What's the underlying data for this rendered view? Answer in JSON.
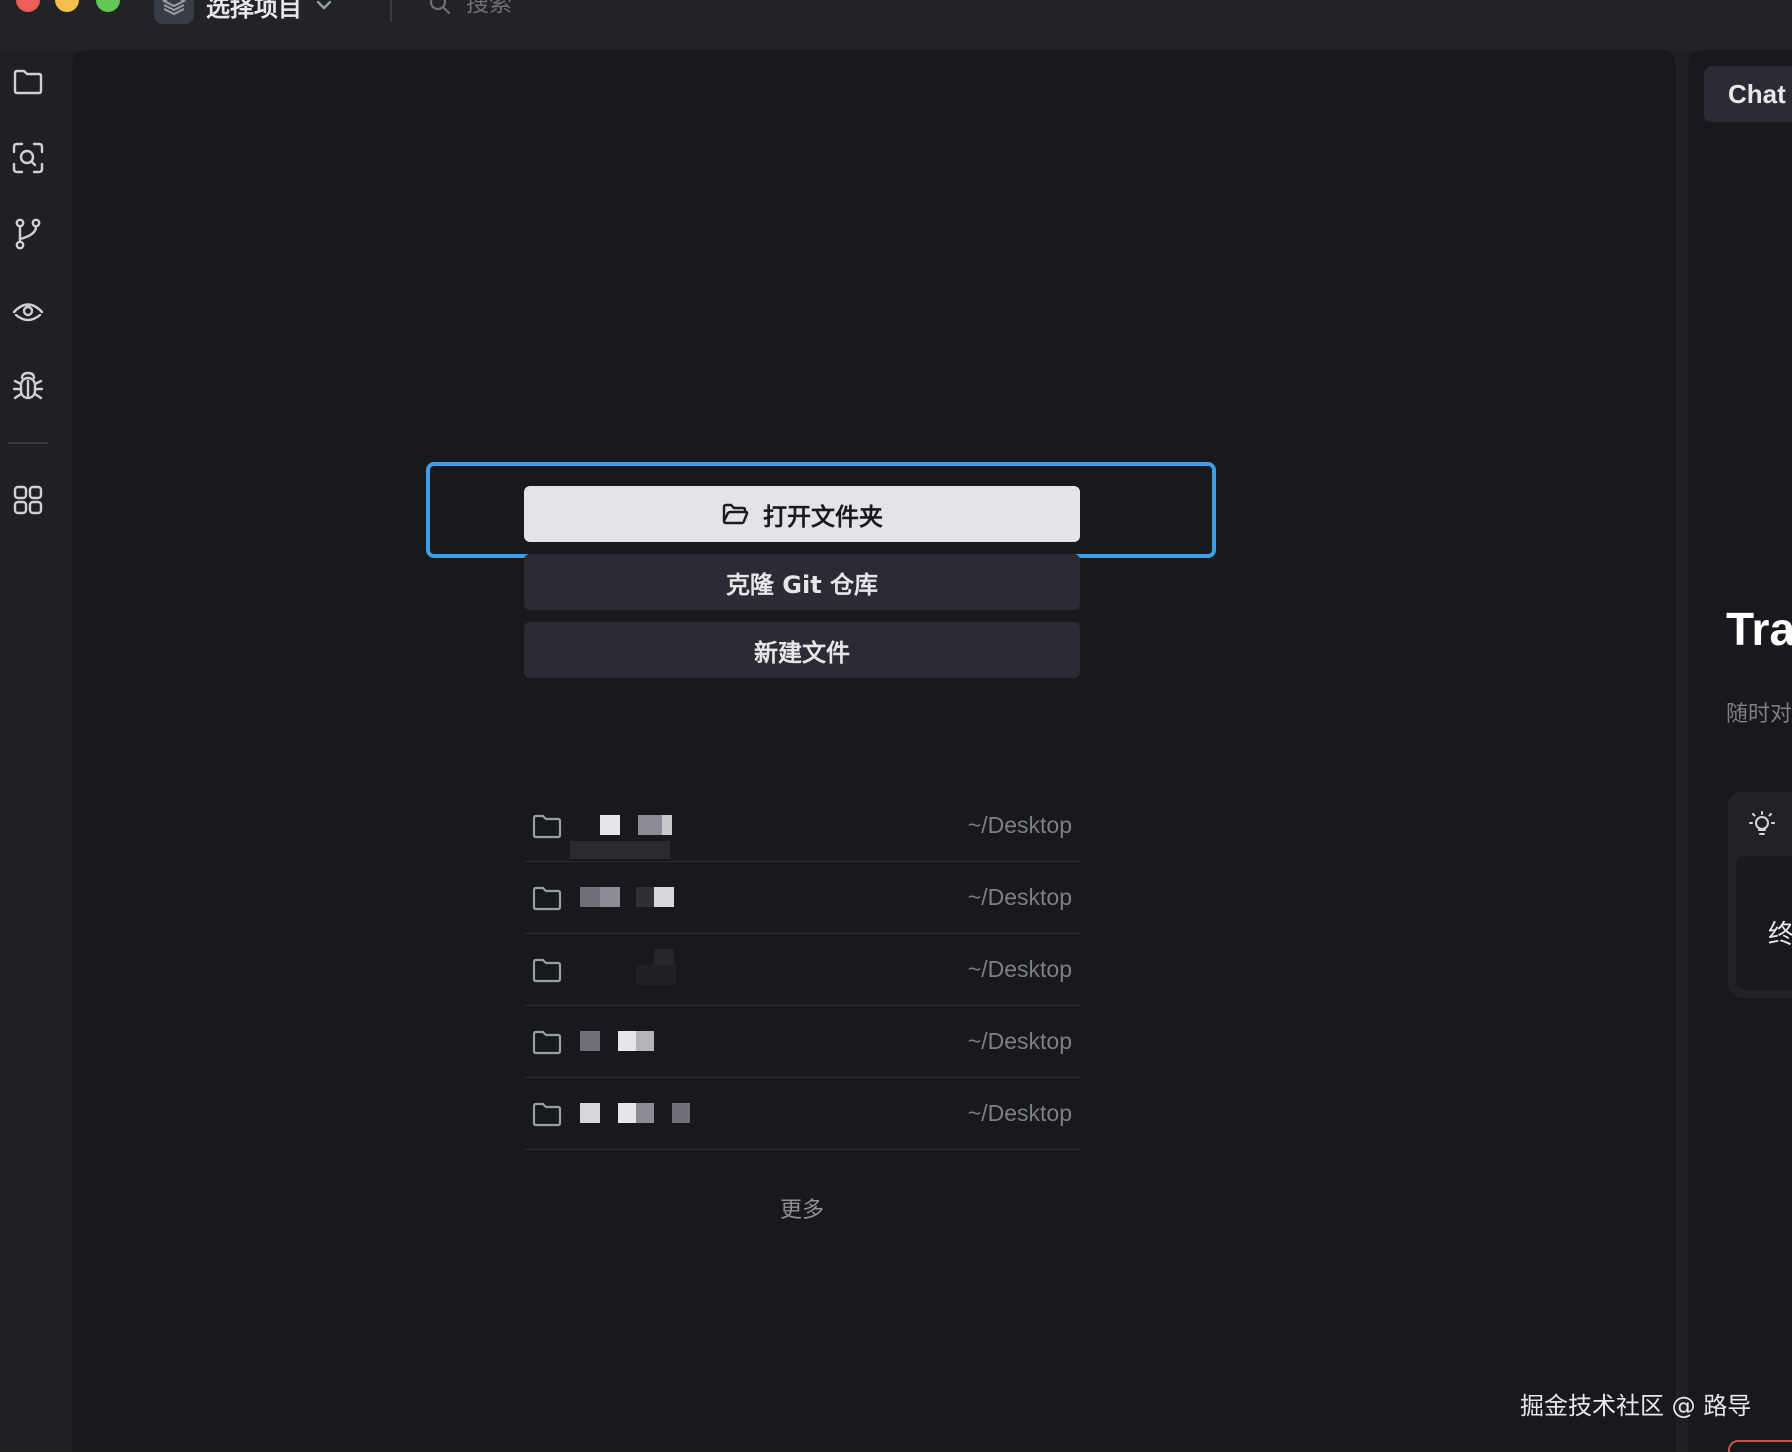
{
  "titlebar": {
    "project_label": "选择项目",
    "search_placeholder": "搜索"
  },
  "activity_bar": {
    "items": [
      "folder-icon",
      "search-icon",
      "branch-icon",
      "eye-icon",
      "bug-icon",
      "apps-icon"
    ]
  },
  "main": {
    "actions": {
      "open_folder": "打开文件夹",
      "clone_git": "克隆 Git 仓库",
      "new_file": "新建文件"
    },
    "recent": [
      {
        "path": "~/Desktop"
      },
      {
        "path": "~/Desktop"
      },
      {
        "path": "~/Desktop"
      },
      {
        "path": "~/Desktop"
      },
      {
        "path": "~/Desktop"
      }
    ],
    "more_label": "更多"
  },
  "chat": {
    "tab_label": "Chat",
    "hero_title": "Tra",
    "subtitle": "随时对",
    "card_text": "终"
  },
  "watermark": "掘金技术社区 @ 路导",
  "colors": {
    "accent_focus": "#3c9ee6",
    "background": "#18191d",
    "titlebar": "#222327"
  }
}
